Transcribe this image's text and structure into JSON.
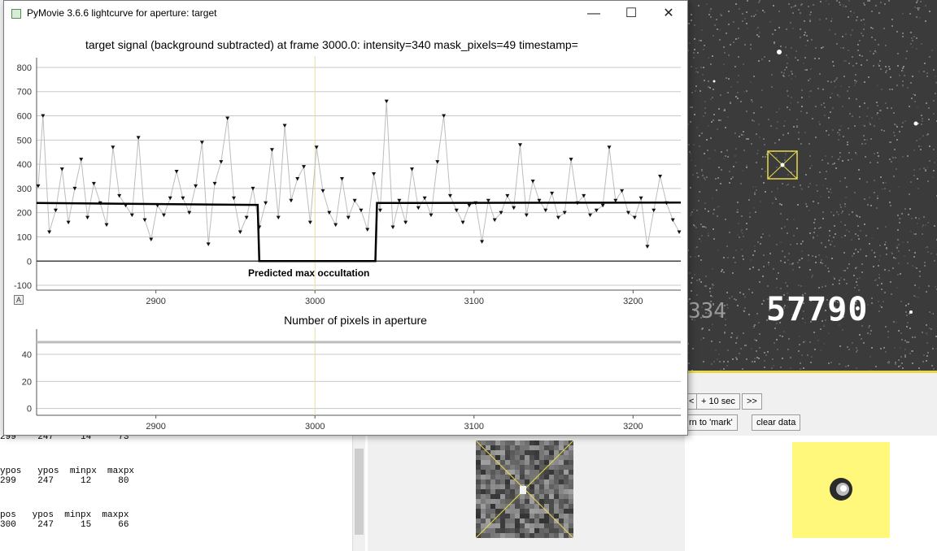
{
  "window": {
    "title": "PyMovie 3.6.6 lightcurve for aperture: target",
    "controls": [
      "—",
      "☐",
      "✕"
    ]
  },
  "plot1": {
    "title": "target signal (background subtracted) at frame 3000.0: intensity=340 mask_pixels=49 timestamp=",
    "annotation": "Predicted max occultation",
    "autorange_button": "A"
  },
  "plot2": {
    "title": "Number of pixels in aperture"
  },
  "chart_data": [
    {
      "type": "scatter",
      "title": "target signal (background subtracted) at frame 3000.0: intensity=340 mask_pixels=49 timestamp=",
      "xlabel": "",
      "ylabel": "",
      "xlim": [
        2825,
        3230
      ],
      "ylim": [
        -120,
        820
      ],
      "xticks": [
        2900,
        3000,
        3100,
        3200
      ],
      "yticks": [
        -100,
        0,
        100,
        200,
        300,
        400,
        500,
        600,
        700,
        800
      ],
      "grid": true,
      "cursor_x": 3000,
      "series": [
        {
          "x": [
            2826,
            2829,
            2833,
            2837,
            2841,
            2845,
            2849,
            2853,
            2857,
            2861,
            2865,
            2869,
            2873,
            2877,
            2881,
            2885,
            2889,
            2893,
            2897,
            2901,
            2905,
            2909,
            2913,
            2917,
            2921,
            2925,
            2929,
            2933,
            2937,
            2941,
            2945,
            2949,
            2953,
            2957,
            2961,
            2965,
            2969,
            2973,
            2977,
            2981,
            2985,
            2989,
            2993,
            2997,
            3001,
            3005,
            3009,
            3013,
            3017,
            3021,
            3025,
            3029,
            3033,
            3037,
            3041,
            3045,
            3049,
            3053,
            3057,
            3061,
            3065,
            3069,
            3073,
            3077,
            3081,
            3085,
            3089,
            3093,
            3097,
            3101,
            3105,
            3109,
            3113,
            3117,
            3121,
            3125,
            3129,
            3133,
            3137,
            3141,
            3145,
            3149,
            3153,
            3157,
            3161,
            3165,
            3169,
            3173,
            3177,
            3181,
            3185,
            3189,
            3193,
            3197,
            3201,
            3205,
            3209,
            3213,
            3217,
            3221,
            3225,
            3229
          ],
          "y": [
            310,
            600,
            120,
            210,
            380,
            160,
            300,
            420,
            180,
            320,
            240,
            150,
            470,
            270,
            230,
            190,
            510,
            170,
            90,
            230,
            190,
            260,
            370,
            260,
            200,
            310,
            490,
            70,
            320,
            410,
            590,
            260,
            120,
            180,
            300,
            140,
            240,
            460,
            180,
            560,
            250,
            340,
            390,
            160,
            470,
            290,
            200,
            150,
            340,
            180,
            250,
            210,
            130,
            360,
            210,
            660,
            140,
            250,
            160,
            380,
            220,
            260,
            190,
            410,
            600,
            270,
            210,
            160,
            230,
            240,
            80,
            250,
            170,
            200,
            270,
            220,
            480,
            190,
            330,
            250,
            210,
            280,
            180,
            200,
            420,
            240,
            270,
            190,
            210,
            230,
            470,
            250,
            290,
            200,
            180,
            260,
            60,
            210,
            350,
            240,
            170,
            120
          ]
        },
        {
          "name": "",
          "x": [
            2825,
            2963,
            2964,
            2965,
            3037,
            3038,
            3039,
            3230
          ],
          "y": [
            240,
            232,
            232,
            0,
            0,
            0,
            240,
            242
          ]
        }
      ]
    },
    {
      "type": "line",
      "title": "Number of pixels in aperture",
      "xlim": [
        2825,
        3230
      ],
      "ylim": [
        -5,
        55
      ],
      "xticks": [
        2900,
        3000,
        3100,
        3200
      ],
      "yticks": [
        0,
        20,
        40
      ],
      "grid": true,
      "cursor_x": 3000,
      "series": [
        {
          "x": [
            2825,
            3230
          ],
          "y": [
            49,
            49
          ]
        }
      ]
    }
  ],
  "background": {
    "frame_timestamp": "57790",
    "frame_timestamp_left": "334",
    "buttons": {
      "left_partial": "<",
      "plus10": "+ 10 sec",
      "forward": ">>",
      "return_mark": "rn to 'mark'",
      "clear": "clear data"
    },
    "text_lines": [
      "299    247     14     73",
      "",
      "",
      "ypos   ypos  minpx  maxpx",
      "299    247     12     80",
      "",
      "",
      "pos   ypos  minpx  maxpx",
      "300    247     15     66"
    ]
  },
  "colors": {
    "cursor": "#e6e09c",
    "frame_bg": "#3b3b3b",
    "aperture_box": "#e8d94a",
    "yellow_panel": "#fff87a"
  }
}
